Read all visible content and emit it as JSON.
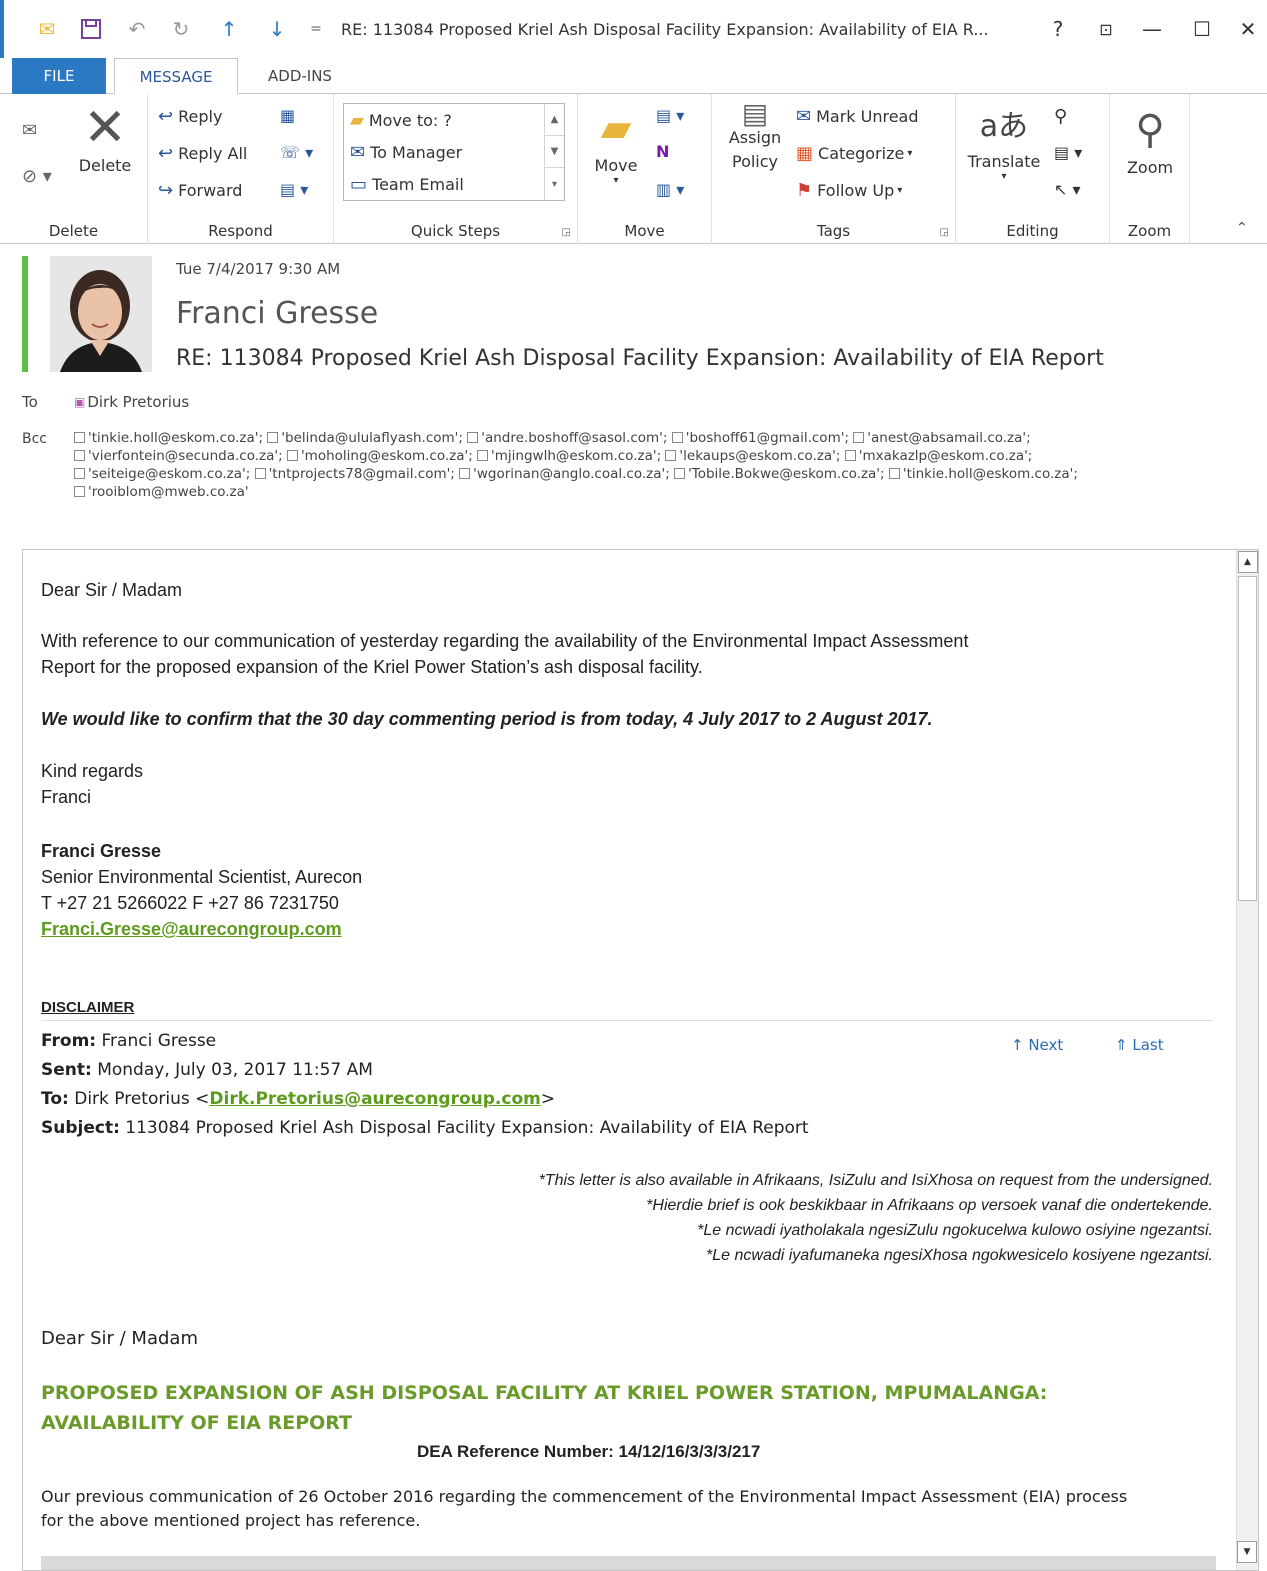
{
  "window": {
    "title": "RE: 113084 Proposed Kriel Ash Disposal Facility Expansion: Availability of EIA R...",
    "help": "?",
    "restore_ribbon": "⊡",
    "minimize": "—",
    "maximize": "☐",
    "close": "✕"
  },
  "tabs": {
    "file": "FILE",
    "message": "MESSAGE",
    "addins": "ADD-INS"
  },
  "ribbon": {
    "delete_group": {
      "delete": "Delete",
      "label": "Delete"
    },
    "respond_group": {
      "reply": "Reply",
      "reply_all": "Reply All",
      "forward": "Forward",
      "label": "Respond"
    },
    "quick_steps": {
      "items": [
        "Move to: ?",
        "To Manager",
        "Team Email"
      ],
      "label": "Quick Steps"
    },
    "move_group": {
      "move": "Move",
      "label": "Move"
    },
    "tags_group": {
      "assign": "Assign",
      "policy": "Policy",
      "mark_unread": "Mark Unread",
      "categorize": "Categorize",
      "follow_up": "Follow Up",
      "label": "Tags"
    },
    "editing_group": {
      "translate": "Translate",
      "label": "Editing"
    },
    "zoom_group": {
      "zoom": "Zoom",
      "label": "Zoom"
    }
  },
  "message": {
    "date": "Tue 7/4/2017 9:30 AM",
    "sender": "Franci Gresse",
    "subject": "RE: 113084 Proposed Kriel Ash Disposal Facility Expansion: Availability of EIA Report",
    "to_label": "To",
    "to": "Dirk Pretorius",
    "bcc_label": "Bcc",
    "bcc": [
      "'tinkie.holl@eskom.co.za';",
      "'belinda@ululaflyash.com';",
      "'andre.boshoff@sasol.com';",
      "'boshoff61@gmail.com';",
      "'anest@absamail.co.za';",
      "'vierfontein@secunda.co.za';",
      "'moholing@eskom.co.za';",
      "'mjingwlh@eskom.co.za';",
      "'lekaups@eskom.co.za';",
      "'mxakazlp@eskom.co.za';",
      "'seiteige@eskom.co.za';",
      "'tntprojects78@gmail.com';",
      "'wgorinan@anglo.coal.co.za';",
      "'Tobile.Bokwe@eskom.co.za';",
      "'tinkie.holl@eskom.co.za';",
      "'rooiblom@mweb.co.za'"
    ]
  },
  "body": {
    "greeting": "Dear Sir / Madam",
    "para1_line1": "With reference to our communication of yesterday regarding the availability of the Environmental Impact Assessment",
    "para1_line2": "Report for the proposed expansion of the Kriel Power Station’s ash disposal facility.",
    "para2": "We would like to confirm that the 30 day commenting period is from today, 4 July 2017 to 2 August 2017.",
    "regards1": "Kind regards",
    "regards2": "Franci",
    "sig_name": "Franci Gresse",
    "sig_title": "Senior Environmental Scientist, Aurecon",
    "sig_phone": "T +27 21 5266022 F +27 86 7231750",
    "sig_email": "Franci.Gresse@aurecongroup.com",
    "disclaimer": "DISCLAIMER",
    "from_label": "From:",
    "from": " Franci Gresse",
    "sent_label": "Sent:",
    "sent": " Monday, July 03, 2017 11:57 AM",
    "to_label": "To:",
    "to_name": " Dirk Pretorius <",
    "to_email": "Dirk.Pretorius@aurecongroup.com",
    "to_end": ">",
    "subject_label": "Subject:",
    "subject": " 113084 Proposed Kriel Ash Disposal Facility Expansion: Availability of EIA Report",
    "nav_next": "↑ Next",
    "nav_last": "⇑ Last",
    "lang1": "*This letter is also available in Afrikaans, IsiZulu and IsiXhosa on request from the undersigned.",
    "lang2": "*Hierdie brief is ook beskikbaar in Afrikaans op versoek vanaf die ondertekende.",
    "lang3": "*Le ncwadi iyatholakala ngesiZulu ngokucelwa kulowo osiyine ngezantsi.",
    "lang4": "*Le ncwadi iyafumaneka ngesiXhosa ngokwesicelo kosiyene ngezantsi.",
    "greeting2": "Dear Sir / Madam",
    "heading1": "PROPOSED EXPANSION OF ASH DISPOSAL FACILITY AT KRIEL POWER STATION, MPUMALANGA:",
    "heading2": "AVAILABILITY OF EIA REPORT",
    "dea_ref": "DEA Reference Number: 14/12/16/3/3/3/217",
    "para3_line1": "Our previous communication of 26 October 2016 regarding the commencement of the Environmental Impact Assessment (EIA) process",
    "para3_line2": "for the above mentioned project has reference."
  },
  "colors": {
    "accent": "#2b79c3",
    "presence": "#5bc043",
    "link": "#5d9b1d",
    "heading": "#6a9a2a"
  }
}
